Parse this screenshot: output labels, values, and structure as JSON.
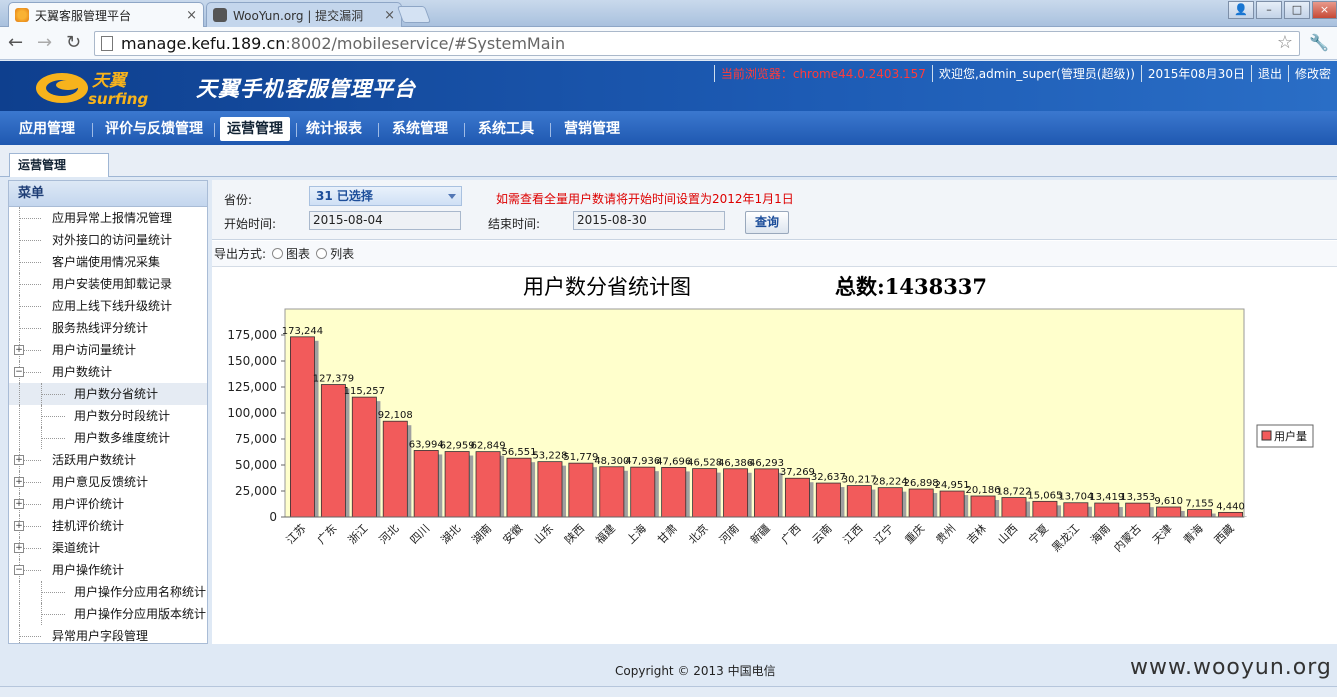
{
  "browser": {
    "tabs": [
      {
        "title": "天翼客服管理平台",
        "active": true
      },
      {
        "title": "WooYun.org | 提交漏洞",
        "active": false
      }
    ],
    "url_host": "manage.kefu.189.cn",
    "url_rest": ":8002/mobileservice/#SystemMain"
  },
  "header": {
    "logo_text": "天翼",
    "logo_sub": "surfing",
    "title": "天翼手机客服管理平台",
    "browser_info": "当前浏览器：chrome44.0.2403.157",
    "welcome": "欢迎您,admin_super(管理员(超级))",
    "date": "2015年08月30日",
    "logout": "退出",
    "change_pwd": "修改密"
  },
  "menu": [
    {
      "label": "应用管理"
    },
    {
      "label": "评价与反馈管理"
    },
    {
      "label": "运营管理",
      "active": true
    },
    {
      "label": "统计报表"
    },
    {
      "label": "系统管理"
    },
    {
      "label": "系统工具"
    },
    {
      "label": "营销管理"
    }
  ],
  "subtab": "运营管理",
  "sidebar": {
    "heading": "菜单",
    "items": [
      {
        "label": "应用异常上报情况管理",
        "level": 1
      },
      {
        "label": "对外接口的访问量统计",
        "level": 1
      },
      {
        "label": "客户端使用情况采集",
        "level": 1
      },
      {
        "label": "用户安装使用卸载记录",
        "level": 1
      },
      {
        "label": "应用上线下线升级统计",
        "level": 1
      },
      {
        "label": "服务热线评分统计",
        "level": 1
      },
      {
        "label": "用户访问量统计",
        "level": 1,
        "expander": "+"
      },
      {
        "label": "用户数统计",
        "level": 1,
        "expander": "−"
      },
      {
        "label": "用户数分省统计",
        "level": 2,
        "selected": true
      },
      {
        "label": "用户数分时段统计",
        "level": 2
      },
      {
        "label": "用户数多维度统计",
        "level": 2
      },
      {
        "label": "活跃用户数统计",
        "level": 1,
        "expander": "+"
      },
      {
        "label": "用户意见反馈统计",
        "level": 1,
        "expander": "+"
      },
      {
        "label": "用户评价统计",
        "level": 1,
        "expander": "+"
      },
      {
        "label": "挂机评价统计",
        "level": 1,
        "expander": "+"
      },
      {
        "label": "渠道统计",
        "level": 1,
        "expander": "+"
      },
      {
        "label": "用户操作统计",
        "level": 1,
        "expander": "−"
      },
      {
        "label": "用户操作分应用名称统计",
        "level": 2
      },
      {
        "label": "用户操作分应用版本统计",
        "level": 2
      },
      {
        "label": "异常用户字段管理",
        "level": 1
      }
    ]
  },
  "filters": {
    "province_label": "省份:",
    "province_value": "31 已选择",
    "notice": "如需查看全量用户数请将开始时间设置为2012年1月1日",
    "start_label": "开始时间:",
    "start_value": "2015-08-04",
    "end_label": "结束时间:",
    "end_value": "2015-08-30",
    "query_button": "查询",
    "export_label": "导出方式:",
    "export_options": [
      "图表",
      "列表"
    ]
  },
  "chart_title": "用户数分省统计图",
  "chart_total": "总数:1438337",
  "chart_data": {
    "type": "bar",
    "categories": [
      "江苏",
      "广东",
      "浙江",
      "河北",
      "四川",
      "湖北",
      "湖南",
      "安徽",
      "山东",
      "陕西",
      "福建",
      "上海",
      "甘肃",
      "北京",
      "河南",
      "新疆",
      "广西",
      "云南",
      "江西",
      "辽宁",
      "重庆",
      "贵州",
      "吉林",
      "山西",
      "宁夏",
      "黑龙江",
      "海南",
      "内蒙古",
      "天津",
      "青海",
      "西藏"
    ],
    "values": [
      173244,
      127379,
      115257,
      92108,
      63994,
      62959,
      62849,
      56551,
      53228,
      51779,
      48300,
      47936,
      47696,
      46528,
      46386,
      46293,
      37269,
      32637,
      30217,
      28224,
      26898,
      24951,
      20186,
      18722,
      15065,
      13704,
      13419,
      13353,
      9610,
      7155,
      4440
    ],
    "ylim": [
      0,
      200000
    ],
    "yticks": [
      0,
      25000,
      50000,
      75000,
      100000,
      125000,
      150000,
      175000
    ],
    "legend": [
      "用户量"
    ],
    "legend_position": "right",
    "bar_color": "#f25b5b",
    "plot_bg": "#ffffcc"
  },
  "footer": "Copyright © 2013 中国电信",
  "watermark": "www.wooyun.org"
}
